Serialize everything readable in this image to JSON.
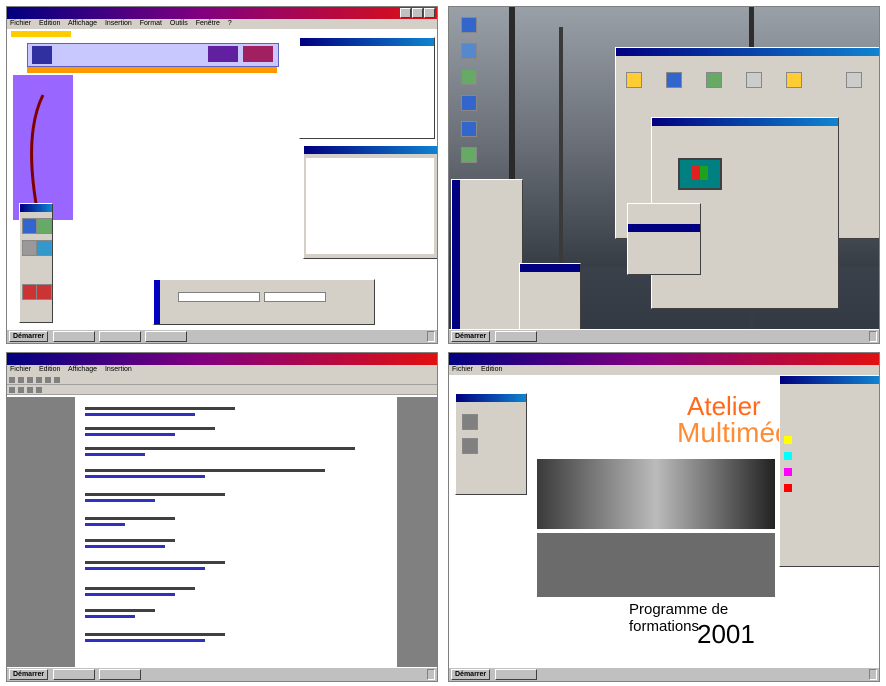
{
  "q1": {
    "title": "",
    "menu": [
      "Fichier",
      "Edition",
      "Affichage",
      "Insertion",
      "Format",
      "Outils",
      "Fenêtre",
      "?"
    ]
  },
  "q2": {
    "desktop_icons": [
      "",
      "",
      "",
      "",
      "",
      ""
    ]
  },
  "q3": {
    "title": ""
  },
  "q4": {
    "logo_top": "Atelier",
    "logo_main": "Multimédia",
    "programme": "Programme de formations",
    "year": "2001"
  },
  "taskbar": {
    "start_label": "Démarrer"
  },
  "colors": {
    "titlebar_left": "#000080",
    "titlebar_right": "#e01010",
    "desktop_purple": "#9966ff",
    "accent_orange": "#ff8c33"
  }
}
